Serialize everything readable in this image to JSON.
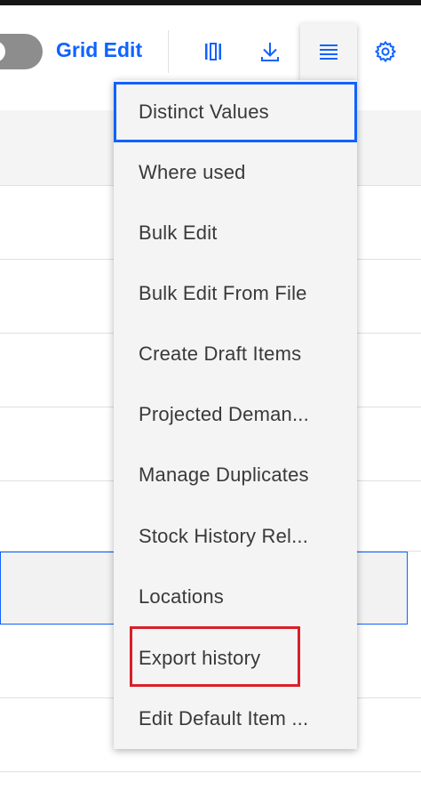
{
  "toolbar": {
    "grid_edit_label": "Grid Edit",
    "icons": [
      "columns-icon",
      "download-icon",
      "overflow-menu-icon",
      "settings-icon"
    ]
  },
  "menu": {
    "items": [
      {
        "label": "Distinct Values"
      },
      {
        "label": "Where used"
      },
      {
        "label": "Bulk Edit"
      },
      {
        "label": "Bulk Edit From File"
      },
      {
        "label": "Create Draft Items"
      },
      {
        "label": "Projected Deman..."
      },
      {
        "label": "Manage Duplicates"
      },
      {
        "label": "Stock History Rel..."
      },
      {
        "label": "Locations"
      },
      {
        "label": "Export history"
      },
      {
        "label": "Edit Default Item ..."
      }
    ],
    "focused_item": "Distinct Values",
    "highlighted_item": "Export history"
  },
  "colors": {
    "accent": "#0f62fe",
    "highlight": "#da1e28",
    "menu_bg": "#f4f4f4",
    "text": "#393939"
  }
}
